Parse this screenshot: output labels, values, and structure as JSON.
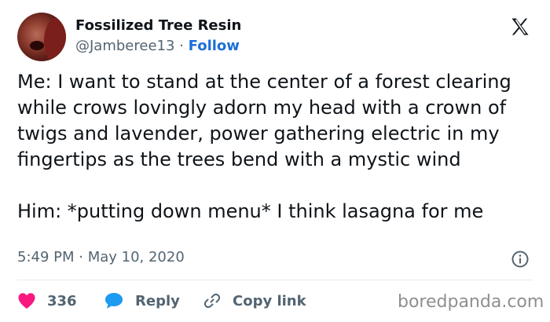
{
  "author": {
    "display_name": "Fossilized Tree Resin",
    "handle": "@Jamberee13",
    "separator": "·",
    "follow_label": "Follow"
  },
  "tweet": {
    "text": "Me: I want to stand at the center of a forest clearing while crows lovingly adorn my head with a crown of twigs and lavender, power gathering electric in my fingertips as the trees bend with a mystic wind\n\nHim: *putting down menu* I think lasagna for me",
    "timestamp": "5:49 PM · May 10, 2020"
  },
  "actions": {
    "like_count": "336",
    "reply_label": "Reply",
    "copy_link_label": "Copy link"
  },
  "watermark": "boredpanda.com",
  "icons": {
    "like": "heart-icon",
    "reply": "speech-bubble-icon",
    "copy_link": "link-icon",
    "info": "info-icon",
    "logo": "x-logo-icon"
  },
  "colors": {
    "like": "#f91880",
    "reply": "#1d9bf0",
    "follow": "#1d6fd6",
    "muted": "#536471"
  }
}
